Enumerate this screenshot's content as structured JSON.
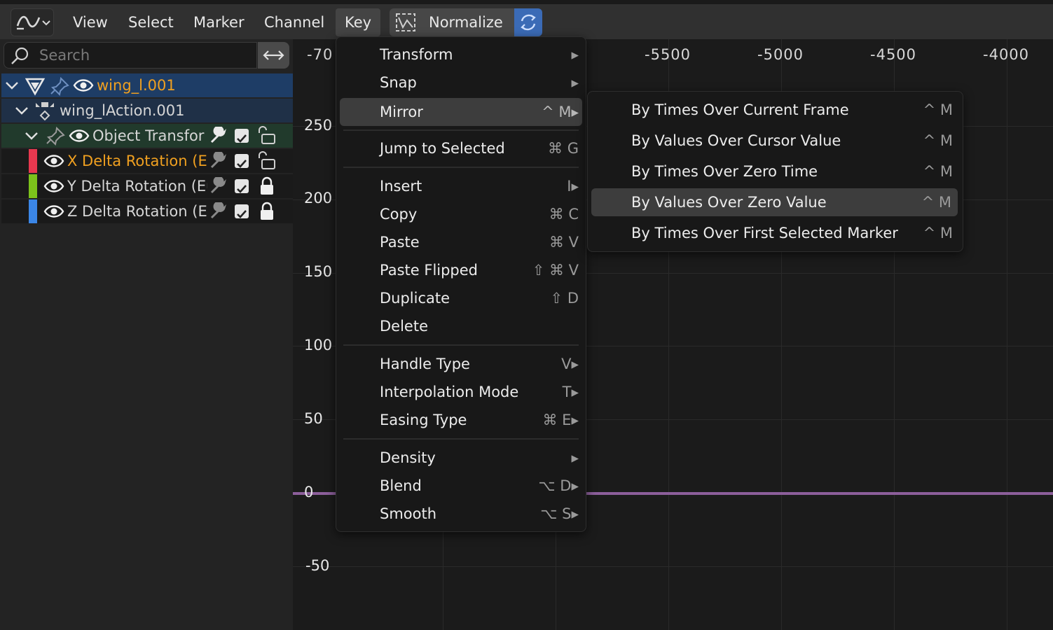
{
  "header": {
    "menus": [
      "View",
      "Select",
      "Marker",
      "Channel",
      "Key"
    ],
    "normalize_label": "Normalize"
  },
  "search": {
    "placeholder": "Search"
  },
  "channels": [
    {
      "label": "wing_l.001",
      "color": "#f0a020"
    },
    {
      "label": "wing_lAction.001",
      "color": "#d6d6d6"
    },
    {
      "label": "Object Transfor",
      "color": "#d6d6d6"
    },
    {
      "label": "X Delta Rotation (Eu",
      "color": "#f0a020",
      "swatch": "#e8384f"
    },
    {
      "label": "Y Delta Rotation (Eu",
      "color": "#d6d6d6",
      "swatch": "#7cc21b"
    },
    {
      "label": "Z Delta Rotation (Eu",
      "color": "#d6d6d6",
      "swatch": "#3b86e6"
    }
  ],
  "graph": {
    "x_ticks": [
      "-70",
      "-5500",
      "-5000",
      "-4500",
      "-4000"
    ],
    "y_ticks": [
      "250",
      "200",
      "150",
      "100",
      "50",
      "0",
      "-50"
    ],
    "curve_color": "#8c5f9b"
  },
  "key_menu": {
    "items": [
      {
        "label": "Transform",
        "shortcut": "▸"
      },
      {
        "label": "Snap",
        "shortcut": "▸"
      },
      {
        "label": "Mirror",
        "shortcut": "^ M▸"
      },
      {
        "label": "Jump to Selected",
        "shortcut": "⌘ G"
      },
      {
        "label": "Insert",
        "shortcut": "I▸"
      },
      {
        "label": "Copy",
        "shortcut": "⌘ C"
      },
      {
        "label": "Paste",
        "shortcut": "⌘ V"
      },
      {
        "label": "Paste Flipped",
        "shortcut": "⇧ ⌘ V"
      },
      {
        "label": "Duplicate",
        "shortcut": "⇧ D"
      },
      {
        "label": "Delete",
        "shortcut": ""
      },
      {
        "label": "Handle Type",
        "shortcut": "V▸"
      },
      {
        "label": "Interpolation Mode",
        "shortcut": "T▸"
      },
      {
        "label": "Easing Type",
        "shortcut": "⌘ E▸"
      },
      {
        "label": "Density",
        "shortcut": "▸"
      },
      {
        "label": "Blend",
        "shortcut": "⌥ D▸"
      },
      {
        "label": "Smooth",
        "shortcut": "⌥ S▸"
      }
    ]
  },
  "mirror_submenu": {
    "items": [
      {
        "label": "By Times Over Current Frame",
        "shortcut": "^ M"
      },
      {
        "label": "By Values Over Cursor Value",
        "shortcut": "^ M"
      },
      {
        "label": "By Times Over Zero Time",
        "shortcut": "^ M"
      },
      {
        "label": "By Values Over Zero Value",
        "shortcut": "^ M"
      },
      {
        "label": "By Times Over First Selected Marker",
        "shortcut": "^ M"
      }
    ]
  }
}
